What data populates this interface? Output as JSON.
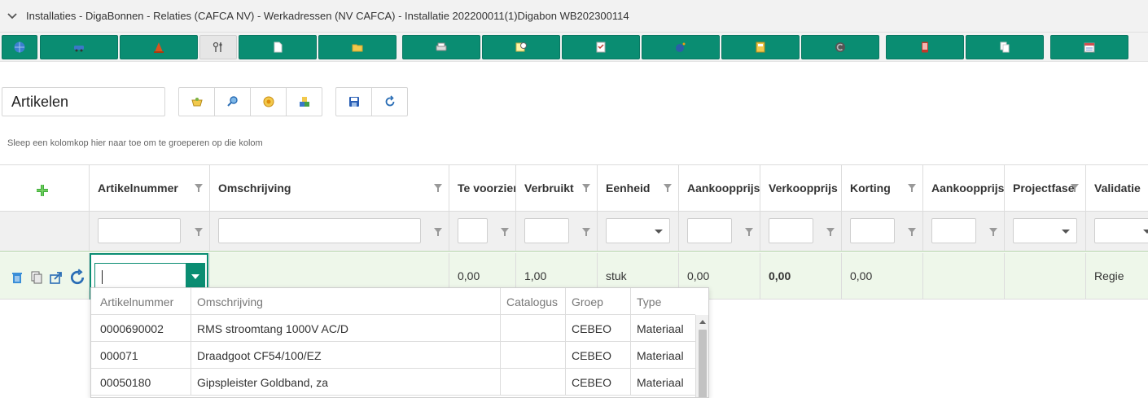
{
  "breadcrumb": "Installaties - DigaBonnen - Relaties (CAFCA NV) - Werkadressen (NV CAFCA) - Installatie 202200011(1)Digabon WB202300114",
  "toolbar": {
    "buttons": [
      {
        "icon": "globe-icon"
      },
      {
        "icon": "car-icon"
      },
      {
        "icon": "cone-icon"
      },
      {
        "icon": "tools-icon",
        "active": true
      },
      {
        "icon": "document-icon"
      },
      {
        "icon": "folder-icon"
      },
      {
        "icon": "printer-icon"
      },
      {
        "icon": "note-clock-icon"
      },
      {
        "icon": "checklist-icon"
      },
      {
        "icon": "bomb-icon"
      },
      {
        "icon": "calculator-icon"
      },
      {
        "icon": "c-coin-icon"
      },
      {
        "icon": "mobile-icon"
      },
      {
        "icon": "copy-icon"
      },
      {
        "icon": "calendar-icon"
      }
    ]
  },
  "section": {
    "title": "Artikelen",
    "actions": [
      "basket-icon",
      "search-icon",
      "coin-icon",
      "blocks-icon"
    ],
    "save_actions": [
      "save-icon",
      "refresh-icon"
    ]
  },
  "group_hint": "Sleep een kolomkop hier naar toe om te groeperen op die kolom",
  "grid": {
    "columns": [
      {
        "label": "Artikelnummer"
      },
      {
        "label": "Omschrijving"
      },
      {
        "label": "Te voorzien"
      },
      {
        "label": "Verbruikt"
      },
      {
        "label": "Eenheid"
      },
      {
        "label": "Aankoopprijs"
      },
      {
        "label": "Verkoopprijs"
      },
      {
        "label": "Korting"
      },
      {
        "label": "Aankoopprijs t"
      },
      {
        "label": "Projectfase"
      },
      {
        "label": "Validatie"
      }
    ],
    "edit_row": {
      "te_voorzien": "0,00",
      "verbruikt": "1,00",
      "eenheid": "stuk",
      "aankoopprijs": "0,00",
      "verkoopprijs": "0,00",
      "korting": "0,00",
      "validatie": "Regie"
    }
  },
  "dropdown": {
    "headers": [
      "Artikelnummer",
      "Omschrijving",
      "Catalogus",
      "Groep",
      "Type"
    ],
    "rows": [
      {
        "nummer": "0000690002",
        "omschrijving": "RMS stroomtang 1000V AC/D",
        "catalogus": "",
        "groep": "CEBEO",
        "type": "Materiaal"
      },
      {
        "nummer": "000071",
        "omschrijving": "Draadgoot CF54/100/EZ",
        "catalogus": "",
        "groep": "CEBEO",
        "type": "Materiaal"
      },
      {
        "nummer": "00050180",
        "omschrijving": "Gipspleister Goldband, za",
        "catalogus": "",
        "groep": "CEBEO",
        "type": "Materiaal"
      }
    ]
  },
  "colors": {
    "accent": "#0a8d72",
    "row_highlight": "#eef7ea",
    "toolbar_bg": "#f2f2f2"
  }
}
